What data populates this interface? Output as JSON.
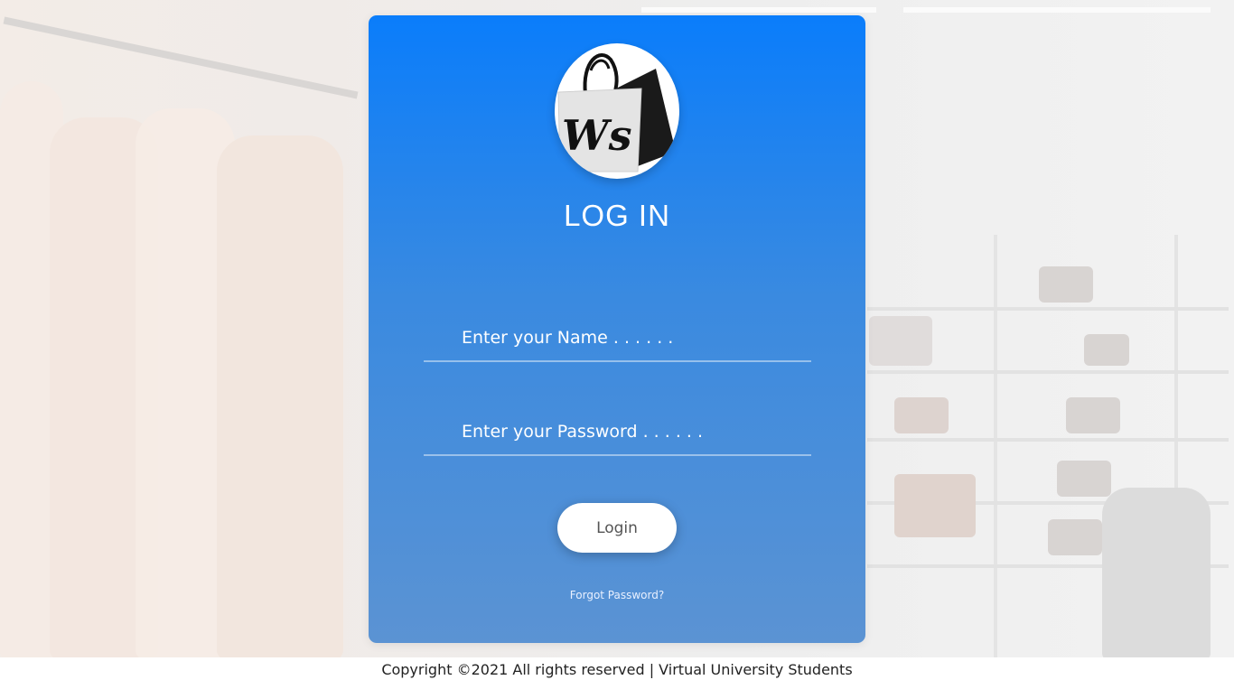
{
  "login_card": {
    "logo_text": "Ws",
    "title": "LOG IN",
    "name_field": {
      "placeholder": "Enter your Name . . . . . .",
      "value": ""
    },
    "password_field": {
      "placeholder": "Enter your Password . . . . . .",
      "value": ""
    },
    "login_label": "Login",
    "forgot_label": "Forgot Password?"
  },
  "footer": {
    "text": "Copyright ©2021 All rights reserved | Virtual University Students"
  },
  "colors": {
    "card_top": "#0a7dfb",
    "card_bottom": "#5b93d3",
    "button_bg": "#ffffff",
    "text_light": "#ffffff"
  },
  "icons": {
    "logo": "shopping-bag-logo"
  }
}
